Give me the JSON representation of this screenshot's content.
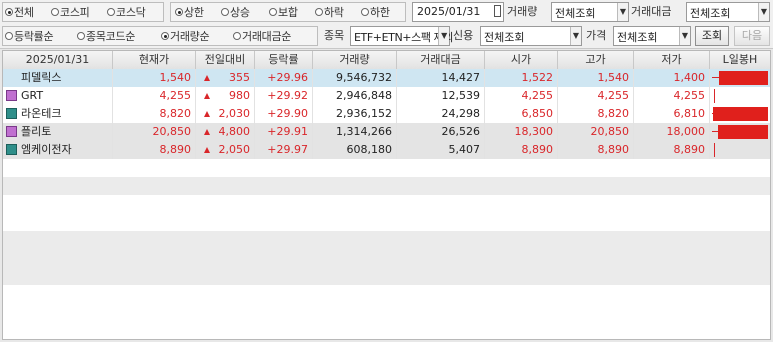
{
  "filters": {
    "market": [
      "전체",
      "코스피",
      "코스닥"
    ],
    "market_selected": 0,
    "movement": [
      "상한",
      "상승",
      "보합",
      "하락",
      "하한"
    ],
    "movement_selected": 0,
    "date": "2025/01/31",
    "volume_label": "거래량",
    "volume_value": "전체조회",
    "amount_label": "거래대금",
    "amount_value": "전체조회",
    "sort": [
      "등락률순",
      "종목코드순",
      "거래량순",
      "거래대금순"
    ],
    "sort_selected": 2,
    "item_label": "종목",
    "item_value": "ETF+ETN+스팩 제외",
    "credit_label": "신용",
    "credit_value": "전체조회",
    "price_label": "가격",
    "price_value": "전체조회",
    "query_button": "조회",
    "next_button": "다음"
  },
  "grid": {
    "headers": [
      "2025/01/31",
      "현재가",
      "전일대비",
      "등락률",
      "거래량",
      "거래대금",
      "시가",
      "고가",
      "저가",
      "L일봉H"
    ],
    "rows": [
      {
        "icon": "",
        "name": "피델릭스",
        "price": "1,540",
        "change": "355",
        "rate": "+29.96",
        "volume": "9,546,732",
        "amount": "14,427",
        "open": "1,522",
        "high": "1,540",
        "low": "1,400",
        "range_low": 0.0,
        "range_open": 0.13,
        "range_close": 1.0
      },
      {
        "icon": "purple-square-icon",
        "name": "GRT",
        "price": "4,255",
        "change": "980",
        "rate": "+29.92",
        "volume": "2,946,848",
        "amount": "12,539",
        "open": "4,255",
        "high": "4,255",
        "low": "4,255",
        "range_low": 0.0,
        "range_open": 0.0,
        "range_close": 0.0
      },
      {
        "icon": "teal-square-icon",
        "name": "라온테크",
        "price": "8,820",
        "change": "2,030",
        "rate": "+29.90",
        "volume": "2,936,152",
        "amount": "24,298",
        "open": "6,850",
        "high": "8,820",
        "low": "6,810",
        "range_low": 0.0,
        "range_open": 0.02,
        "range_close": 1.0
      },
      {
        "icon": "purple-square-icon",
        "name": "플리토",
        "price": "20,850",
        "change": "4,800",
        "rate": "+29.91",
        "volume": "1,314,266",
        "amount": "26,526",
        "open": "18,300",
        "high": "20,850",
        "low": "18,000",
        "range_low": 0.0,
        "range_open": 0.11,
        "range_close": 1.0
      },
      {
        "icon": "teal-square-icon",
        "name": "엠케이전자",
        "price": "8,890",
        "change": "2,050",
        "rate": "+29.97",
        "volume": "608,180",
        "amount": "5,407",
        "open": "8,890",
        "high": "8,890",
        "low": "8,890",
        "range_low": 0.0,
        "range_open": 0.0,
        "range_close": 0.0
      }
    ]
  }
}
